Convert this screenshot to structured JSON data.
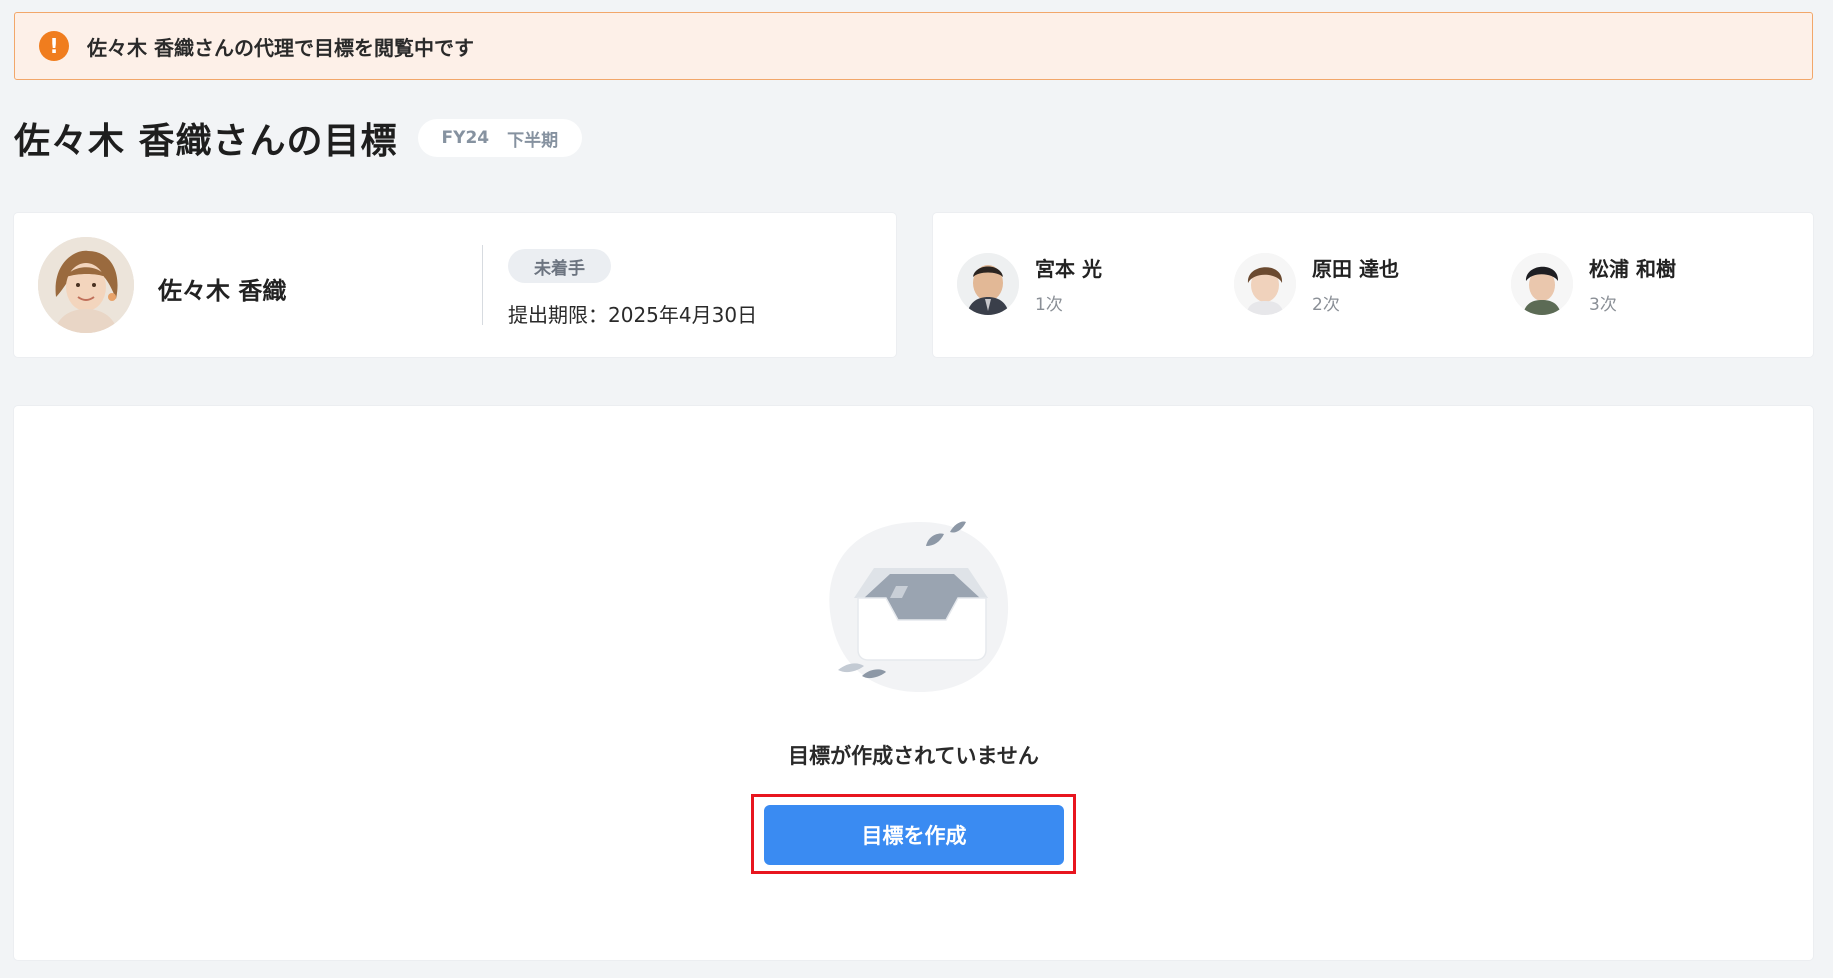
{
  "banner": {
    "message": "佐々木 香織さんの代理で目標を閲覧中です",
    "icon": "warning-icon"
  },
  "header": {
    "title": "佐々木 香織さんの目標",
    "fiscal_year": "FY24",
    "term": "下半期"
  },
  "employee": {
    "name": "佐々木 香織",
    "status": "未着手",
    "deadline": "提出期限：2025年4月30日"
  },
  "approvers": [
    {
      "name": "宮本 光",
      "level": "1次"
    },
    {
      "name": "原田 達也",
      "level": "2次"
    },
    {
      "name": "松浦 和樹",
      "level": "3次"
    }
  ],
  "empty_state": {
    "message": "目標が作成されていません",
    "button_label": "目標を作成"
  },
  "colors": {
    "accent": "#3a8bf2",
    "warning": "#f07d1e",
    "highlight_outline": "#e8151f"
  }
}
